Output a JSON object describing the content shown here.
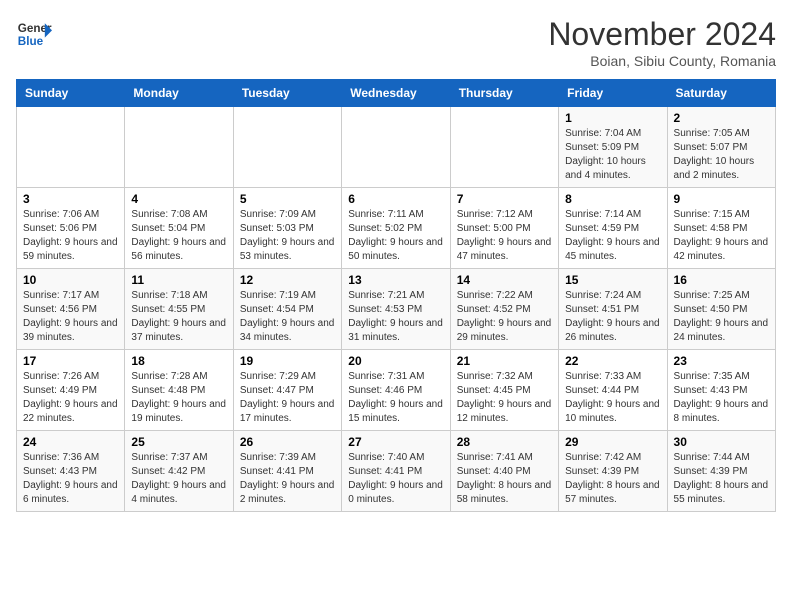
{
  "header": {
    "logo_line1": "General",
    "logo_line2": "Blue",
    "month_title": "November 2024",
    "location": "Boian, Sibiu County, Romania"
  },
  "weekdays": [
    "Sunday",
    "Monday",
    "Tuesday",
    "Wednesday",
    "Thursday",
    "Friday",
    "Saturday"
  ],
  "weeks": [
    [
      {
        "day": "",
        "info": ""
      },
      {
        "day": "",
        "info": ""
      },
      {
        "day": "",
        "info": ""
      },
      {
        "day": "",
        "info": ""
      },
      {
        "day": "",
        "info": ""
      },
      {
        "day": "1",
        "info": "Sunrise: 7:04 AM\nSunset: 5:09 PM\nDaylight: 10 hours and 4 minutes."
      },
      {
        "day": "2",
        "info": "Sunrise: 7:05 AM\nSunset: 5:07 PM\nDaylight: 10 hours and 2 minutes."
      }
    ],
    [
      {
        "day": "3",
        "info": "Sunrise: 7:06 AM\nSunset: 5:06 PM\nDaylight: 9 hours and 59 minutes."
      },
      {
        "day": "4",
        "info": "Sunrise: 7:08 AM\nSunset: 5:04 PM\nDaylight: 9 hours and 56 minutes."
      },
      {
        "day": "5",
        "info": "Sunrise: 7:09 AM\nSunset: 5:03 PM\nDaylight: 9 hours and 53 minutes."
      },
      {
        "day": "6",
        "info": "Sunrise: 7:11 AM\nSunset: 5:02 PM\nDaylight: 9 hours and 50 minutes."
      },
      {
        "day": "7",
        "info": "Sunrise: 7:12 AM\nSunset: 5:00 PM\nDaylight: 9 hours and 47 minutes."
      },
      {
        "day": "8",
        "info": "Sunrise: 7:14 AM\nSunset: 4:59 PM\nDaylight: 9 hours and 45 minutes."
      },
      {
        "day": "9",
        "info": "Sunrise: 7:15 AM\nSunset: 4:58 PM\nDaylight: 9 hours and 42 minutes."
      }
    ],
    [
      {
        "day": "10",
        "info": "Sunrise: 7:17 AM\nSunset: 4:56 PM\nDaylight: 9 hours and 39 minutes."
      },
      {
        "day": "11",
        "info": "Sunrise: 7:18 AM\nSunset: 4:55 PM\nDaylight: 9 hours and 37 minutes."
      },
      {
        "day": "12",
        "info": "Sunrise: 7:19 AM\nSunset: 4:54 PM\nDaylight: 9 hours and 34 minutes."
      },
      {
        "day": "13",
        "info": "Sunrise: 7:21 AM\nSunset: 4:53 PM\nDaylight: 9 hours and 31 minutes."
      },
      {
        "day": "14",
        "info": "Sunrise: 7:22 AM\nSunset: 4:52 PM\nDaylight: 9 hours and 29 minutes."
      },
      {
        "day": "15",
        "info": "Sunrise: 7:24 AM\nSunset: 4:51 PM\nDaylight: 9 hours and 26 minutes."
      },
      {
        "day": "16",
        "info": "Sunrise: 7:25 AM\nSunset: 4:50 PM\nDaylight: 9 hours and 24 minutes."
      }
    ],
    [
      {
        "day": "17",
        "info": "Sunrise: 7:26 AM\nSunset: 4:49 PM\nDaylight: 9 hours and 22 minutes."
      },
      {
        "day": "18",
        "info": "Sunrise: 7:28 AM\nSunset: 4:48 PM\nDaylight: 9 hours and 19 minutes."
      },
      {
        "day": "19",
        "info": "Sunrise: 7:29 AM\nSunset: 4:47 PM\nDaylight: 9 hours and 17 minutes."
      },
      {
        "day": "20",
        "info": "Sunrise: 7:31 AM\nSunset: 4:46 PM\nDaylight: 9 hours and 15 minutes."
      },
      {
        "day": "21",
        "info": "Sunrise: 7:32 AM\nSunset: 4:45 PM\nDaylight: 9 hours and 12 minutes."
      },
      {
        "day": "22",
        "info": "Sunrise: 7:33 AM\nSunset: 4:44 PM\nDaylight: 9 hours and 10 minutes."
      },
      {
        "day": "23",
        "info": "Sunrise: 7:35 AM\nSunset: 4:43 PM\nDaylight: 9 hours and 8 minutes."
      }
    ],
    [
      {
        "day": "24",
        "info": "Sunrise: 7:36 AM\nSunset: 4:43 PM\nDaylight: 9 hours and 6 minutes."
      },
      {
        "day": "25",
        "info": "Sunrise: 7:37 AM\nSunset: 4:42 PM\nDaylight: 9 hours and 4 minutes."
      },
      {
        "day": "26",
        "info": "Sunrise: 7:39 AM\nSunset: 4:41 PM\nDaylight: 9 hours and 2 minutes."
      },
      {
        "day": "27",
        "info": "Sunrise: 7:40 AM\nSunset: 4:41 PM\nDaylight: 9 hours and 0 minutes."
      },
      {
        "day": "28",
        "info": "Sunrise: 7:41 AM\nSunset: 4:40 PM\nDaylight: 8 hours and 58 minutes."
      },
      {
        "day": "29",
        "info": "Sunrise: 7:42 AM\nSunset: 4:39 PM\nDaylight: 8 hours and 57 minutes."
      },
      {
        "day": "30",
        "info": "Sunrise: 7:44 AM\nSunset: 4:39 PM\nDaylight: 8 hours and 55 minutes."
      }
    ]
  ]
}
